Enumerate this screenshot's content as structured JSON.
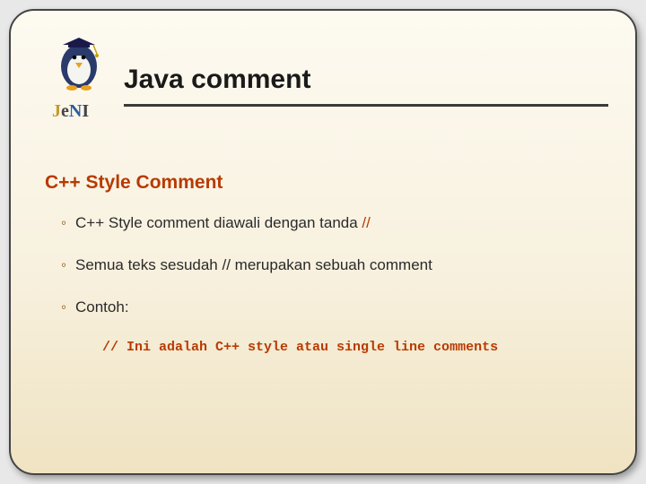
{
  "header": {
    "title": "Java comment",
    "logo_label_top": "JeNI"
  },
  "content": {
    "subtitle": "C++ Style Comment",
    "bullets": [
      {
        "pre": "C++ Style comment diawali dengan tanda ",
        "code": "//"
      },
      {
        "pre": "Semua teks sesudah // merupakan sebuah comment",
        "code": ""
      },
      {
        "pre": "Contoh:",
        "code": ""
      }
    ],
    "example_code": "// Ini adalah C++ style atau single line comments"
  }
}
